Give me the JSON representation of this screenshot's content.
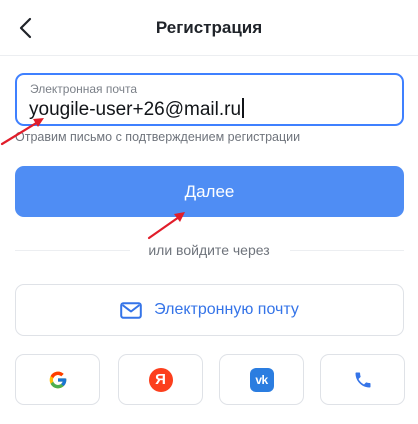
{
  "header": {
    "title": "Регистрация",
    "back_icon": "chevron-left-icon"
  },
  "email_field": {
    "label": "Электронная почта",
    "value": "yougile-user+26@mail.ru",
    "helper": "Отравим письмо с подтверждением регистрации"
  },
  "next_button": {
    "label": "Далее"
  },
  "divider": {
    "text": "или войдите через"
  },
  "email_login": {
    "label": "Электронную почту",
    "icon": "mail-icon"
  },
  "social": {
    "google_icon": "google-icon",
    "yandex_icon": "yandex-icon",
    "yandex_letter": "Я",
    "vk_icon": "vk-icon",
    "vk_letters": "vk",
    "phone_icon": "phone-icon"
  },
  "colors": {
    "primary": "#4f8df4",
    "field_border": "#3f80ff",
    "link": "#3574e8",
    "annotation": "#e11d2a"
  }
}
